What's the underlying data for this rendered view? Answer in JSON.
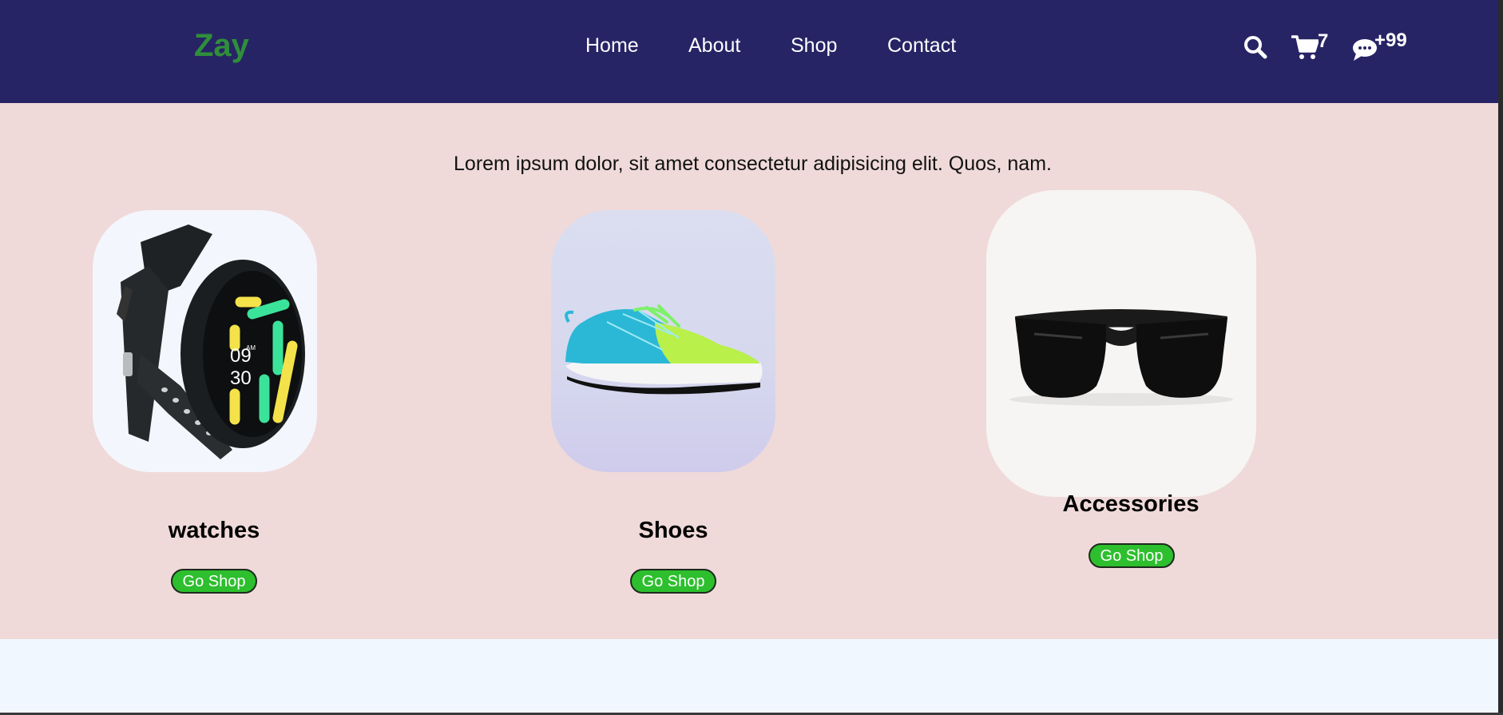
{
  "brand": {
    "name": "Zay"
  },
  "nav": {
    "links": [
      "Home",
      "About",
      "Shop",
      "Contact"
    ],
    "cart_count": "7",
    "messages_count": "+99",
    "icons": [
      "search-icon",
      "cart-icon",
      "chat-icon"
    ]
  },
  "hero": {
    "tagline": "Lorem ipsum dolor, sit amet consectetur adipisicing elit. Quos, nam."
  },
  "categories": [
    {
      "title": "watches",
      "button": "Go Shop",
      "image": "smartwatch"
    },
    {
      "title": "Shoes",
      "button": "Go Shop",
      "image": "sneaker"
    },
    {
      "title": "Accessories",
      "button": "Go Shop",
      "image": "sunglasses"
    }
  ],
  "colors": {
    "navbar": "#272465",
    "brand": "#2f8f3a",
    "hero_bg": "#efdad9",
    "button": "#2dbf2d",
    "page_bg": "#f0f7ff"
  }
}
